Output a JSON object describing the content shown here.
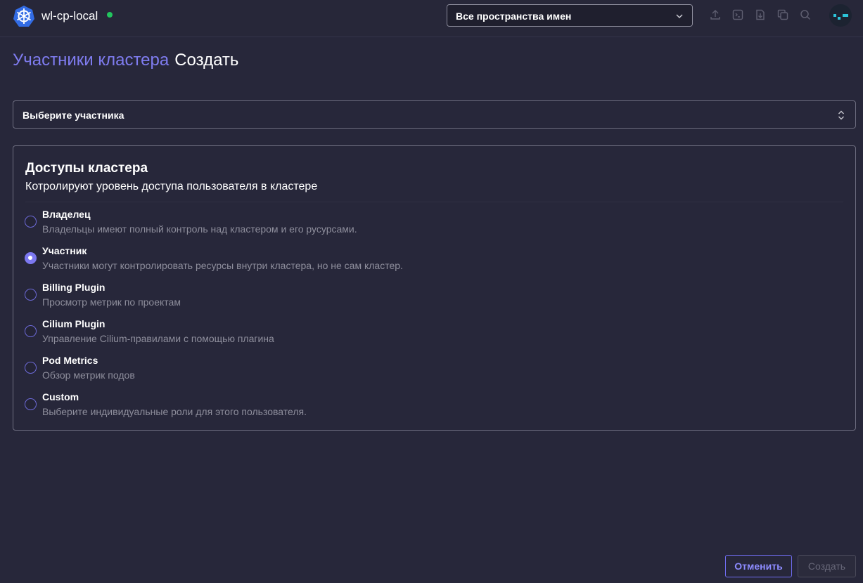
{
  "header": {
    "cluster_name": "wl-cp-local",
    "cluster_status": "connected",
    "namespace_select": "Все пространства имен",
    "toolbar_icons": [
      "upload-icon",
      "terminal-icon",
      "import-file-icon",
      "copy-icon",
      "search-icon"
    ],
    "avatar": "user-avatar"
  },
  "page": {
    "breadcrumb": "Участники кластера",
    "action": "Создать"
  },
  "member_select": {
    "placeholder": "Выберите участника"
  },
  "permissions": {
    "title": "Доступы кластера",
    "subtitle": "Котролируют уровень доступа пользователя в кластере",
    "options": [
      {
        "label": "Владелец",
        "description": "Владельцы имеют полный контроль над кластером и его русурсами.",
        "checked": false
      },
      {
        "label": "Участник",
        "description": "Участники могут контролировать ресурсы внутри кластера, но не сам кластер.",
        "checked": true
      },
      {
        "label": "Billing Plugin",
        "description": "Просмотр метрик по проектам",
        "checked": false
      },
      {
        "label": "Cilium Plugin",
        "description": "Управление Cilium-правилами с помощью плагина",
        "checked": false
      },
      {
        "label": "Pod Metrics",
        "description": "Обзор метрик подов",
        "checked": false
      },
      {
        "label": "Custom",
        "description": "Выберите индивидуальные роли для этого пользователя.",
        "checked": false
      }
    ]
  },
  "footer": {
    "cancel_label": "Отменить",
    "create_label": "Создать"
  },
  "colors": {
    "accent": "#7c78f0",
    "status_online": "#22c55e",
    "background": "#27273a"
  }
}
